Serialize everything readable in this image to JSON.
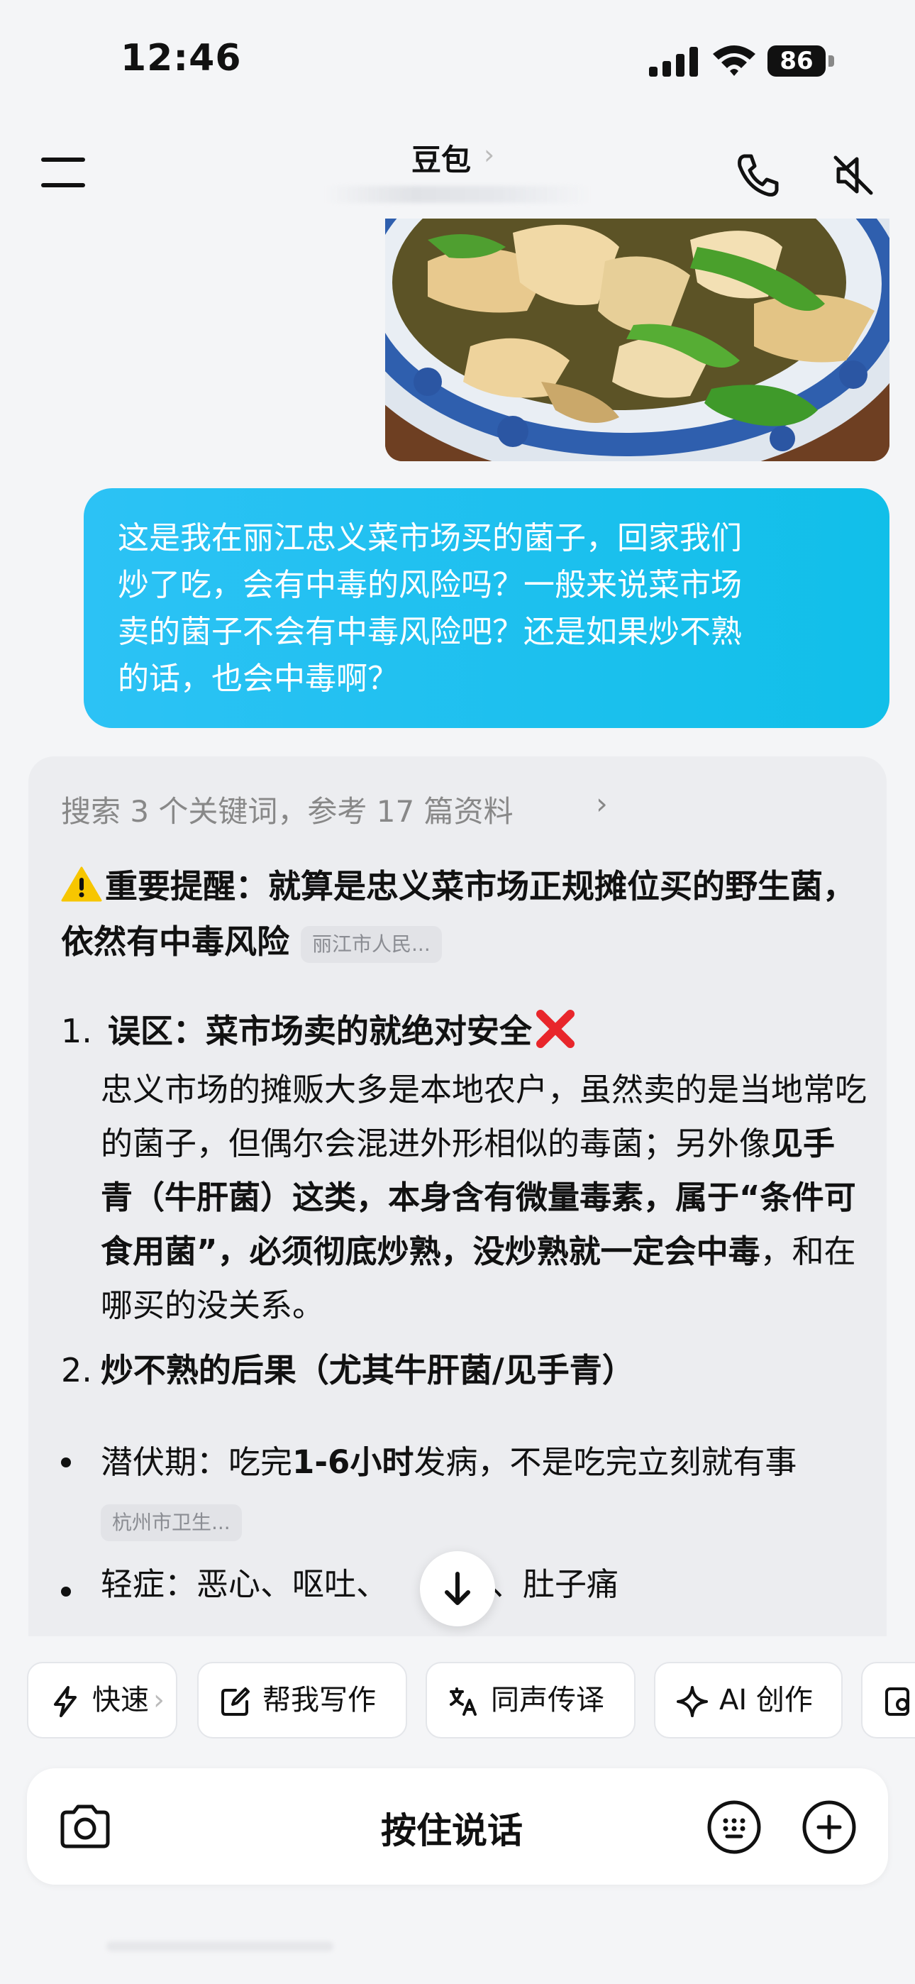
{
  "status_bar": {
    "time": "12:46",
    "battery": "86"
  },
  "nav": {
    "title": "豆包",
    "title_chevron": "›"
  },
  "user_message": {
    "text": "这是我在丽江忠义菜市场买的菌子，回家我们\n炒了吃，会有中毒的风险吗？一般来说菜市场\n卖的菌子不会有中毒风险吧？还是如果炒不熟\n的话，也会中毒啊？"
  },
  "answer": {
    "search_summary": "搜索 3 个关键词，参考 17 篇资料",
    "search_chevron": "›",
    "warning": {
      "label": "重要提醒：",
      "text": "就算是忠义菜市场正规摊位买的野生菌，依然有中毒风险",
      "citation": "丽江市人民..."
    },
    "item1": {
      "number": "1.",
      "title": "误区：菜市场卖的就绝对安全",
      "body_plain1": "忠义市场的摊贩大多是本地农户，虽然卖的是当地常吃的菌子，但偶尔会混进外形相似的毒菌；另外像",
      "body_bold1": "见手青（牛肝菌）这类，本身含有微量毒素，属于“条件可食用菌”，必须彻底炒熟，没炒熟就一定会中毒",
      "body_plain2": "，和在哪买的没关系。"
    },
    "item2": {
      "number": "2.",
      "title": "炒不熟的后果（尤其牛肝菌/见手青）"
    },
    "bullets": [
      {
        "label": "潜伏期：",
        "pre": "吃完",
        "bold": "1-6小时",
        "post": "发病，不是吃完立刻就有事",
        "citation": "杭州市卫生..."
      },
      {
        "label": "轻症：",
        "text_a": "恶心、呕吐、",
        "text_b": "子、肚子痛"
      }
    ]
  },
  "chips": [
    {
      "label": "快速",
      "suffix": "›",
      "icon": "lightning-icon"
    },
    {
      "label": "帮我写作",
      "icon": "edit-icon"
    },
    {
      "label": "同声传译",
      "icon": "translate-icon"
    },
    {
      "label": "AI 创作",
      "icon": "sparkle-icon"
    }
  ],
  "input_bar": {
    "hold_to_talk": "按住说话"
  },
  "colors": {
    "bubble": "#1cc0ee",
    "warning": "#f7c600",
    "cross": "#e8262b"
  }
}
